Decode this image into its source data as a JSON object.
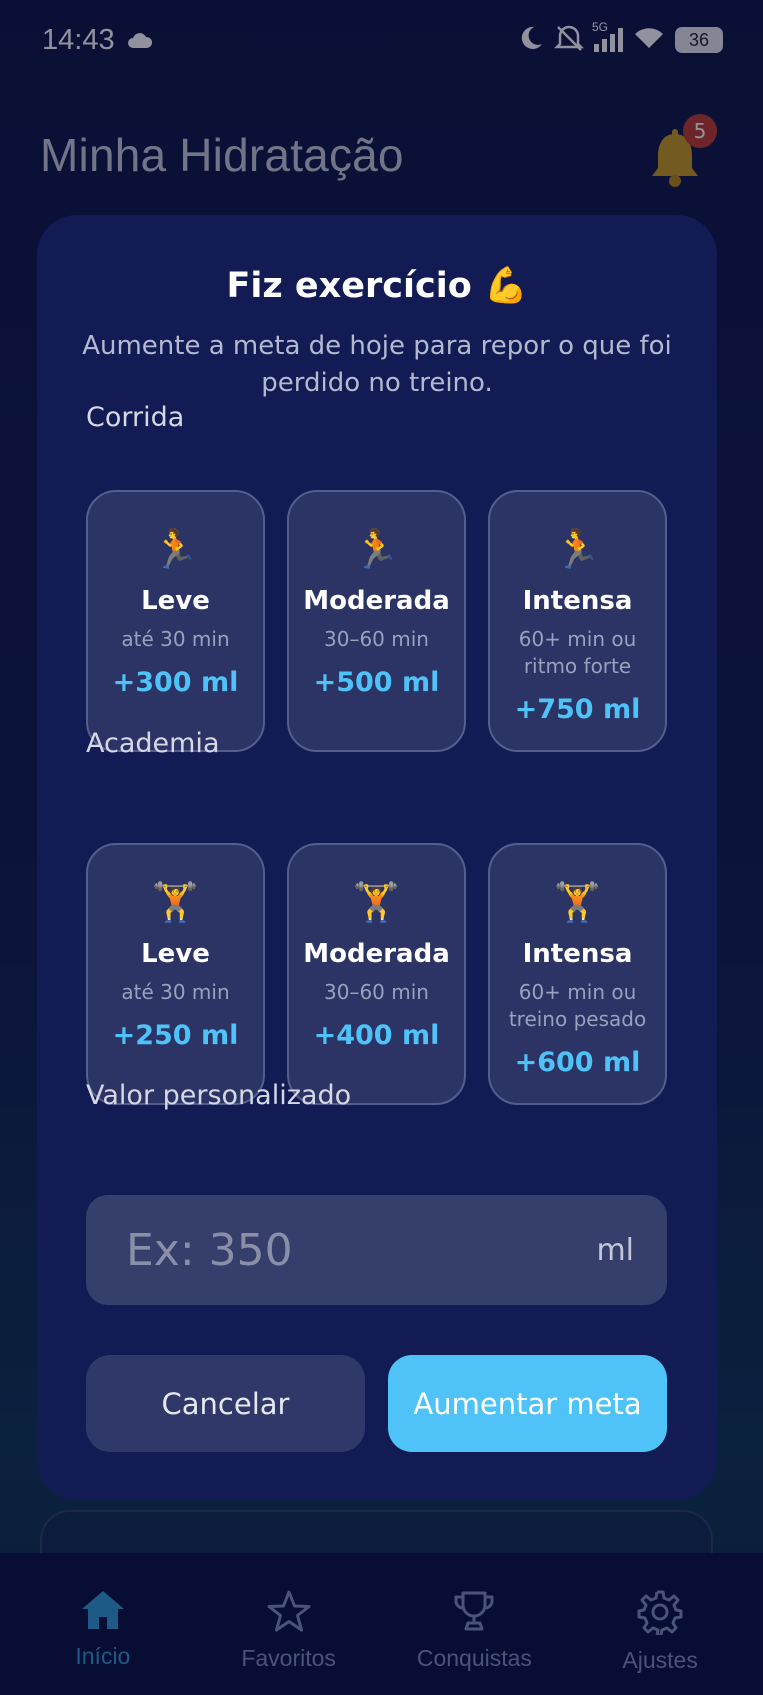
{
  "status_bar": {
    "time": "14:43",
    "battery": "36",
    "network": "5G",
    "icons": [
      "cloud-icon",
      "moon-icon",
      "mute-icon",
      "signal-icon",
      "wifi-icon",
      "battery-icon"
    ]
  },
  "background": {
    "app_title": "Minha Hidratação",
    "notification_count": "5"
  },
  "modal": {
    "title": "Fiz exercício 💪",
    "subtitle": "Aumente a meta de hoje para repor o que foi perdido no treino.",
    "sections": [
      {
        "label": "Corrida",
        "icon": "🏃",
        "options": [
          {
            "name": "Leve",
            "desc": "até 30 min",
            "amount": "+300 ml"
          },
          {
            "name": "Moderada",
            "desc": "30–60 min",
            "amount": "+500 ml"
          },
          {
            "name": "Intensa",
            "desc": "60+ min ou ritmo forte",
            "amount": "+750 ml"
          }
        ]
      },
      {
        "label": "Academia",
        "icon": "🏋️",
        "options": [
          {
            "name": "Leve",
            "desc": "até 30 min",
            "amount": "+250 ml"
          },
          {
            "name": "Moderada",
            "desc": "30–60 min",
            "amount": "+400 ml"
          },
          {
            "name": "Intensa",
            "desc": "60+ min ou treino pesado",
            "amount": "+600 ml"
          }
        ]
      }
    ],
    "custom": {
      "label": "Valor personalizado",
      "placeholder": "Ex: 350",
      "value": "",
      "unit": "ml"
    },
    "cancel_label": "Cancelar",
    "confirm_label": "Aumentar meta"
  },
  "bottom_nav": {
    "items": [
      {
        "label": "Início",
        "icon": "home-icon",
        "active": true
      },
      {
        "label": "Favoritos",
        "icon": "star-icon",
        "active": false
      },
      {
        "label": "Conquistas",
        "icon": "trophy-icon",
        "active": false
      },
      {
        "label": "Ajustes",
        "icon": "gear-icon",
        "active": false
      }
    ]
  },
  "colors": {
    "accent": "#4fc3f7",
    "modal_bg": "#121b54",
    "card_bg": "#2b3464",
    "nav_active": "#1e5a86"
  }
}
